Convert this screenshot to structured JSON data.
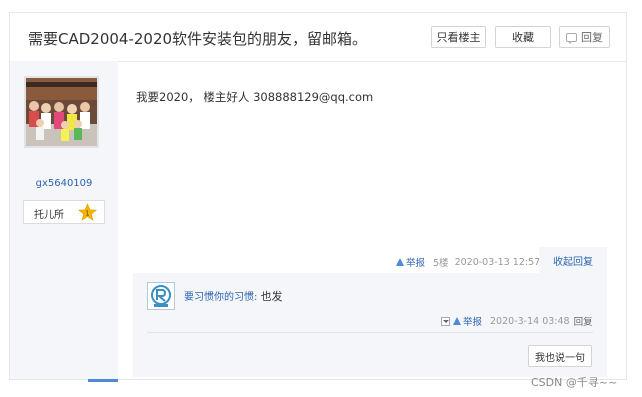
{
  "post": {
    "title": "需要CAD2004-2020软件安装包的朋友，留邮箱。",
    "buttons": {
      "only_author": "只看楼主",
      "favorite": "收藏",
      "reply": "回复"
    }
  },
  "author": {
    "username": "gx5640109",
    "level_title": "托儿所",
    "level_number": "1"
  },
  "reply": {
    "content": "我要2020， 楼主好人 308888129@qq.com",
    "report": "举报",
    "floor": "5楼",
    "time": "2020-03-13 12:57",
    "collapse": "收起回复"
  },
  "comment": {
    "user": "要习惯你的习惯:",
    "text": "也发",
    "report": "举报",
    "time": "2020-3-14 03:48",
    "reply": "回复",
    "say_button": "我也说一句"
  },
  "watermark": "CSDN @千寻~~",
  "colors": {
    "link": "#2d64b3",
    "sidebar_bg": "#f4f6f9",
    "star": "#f5b400"
  }
}
